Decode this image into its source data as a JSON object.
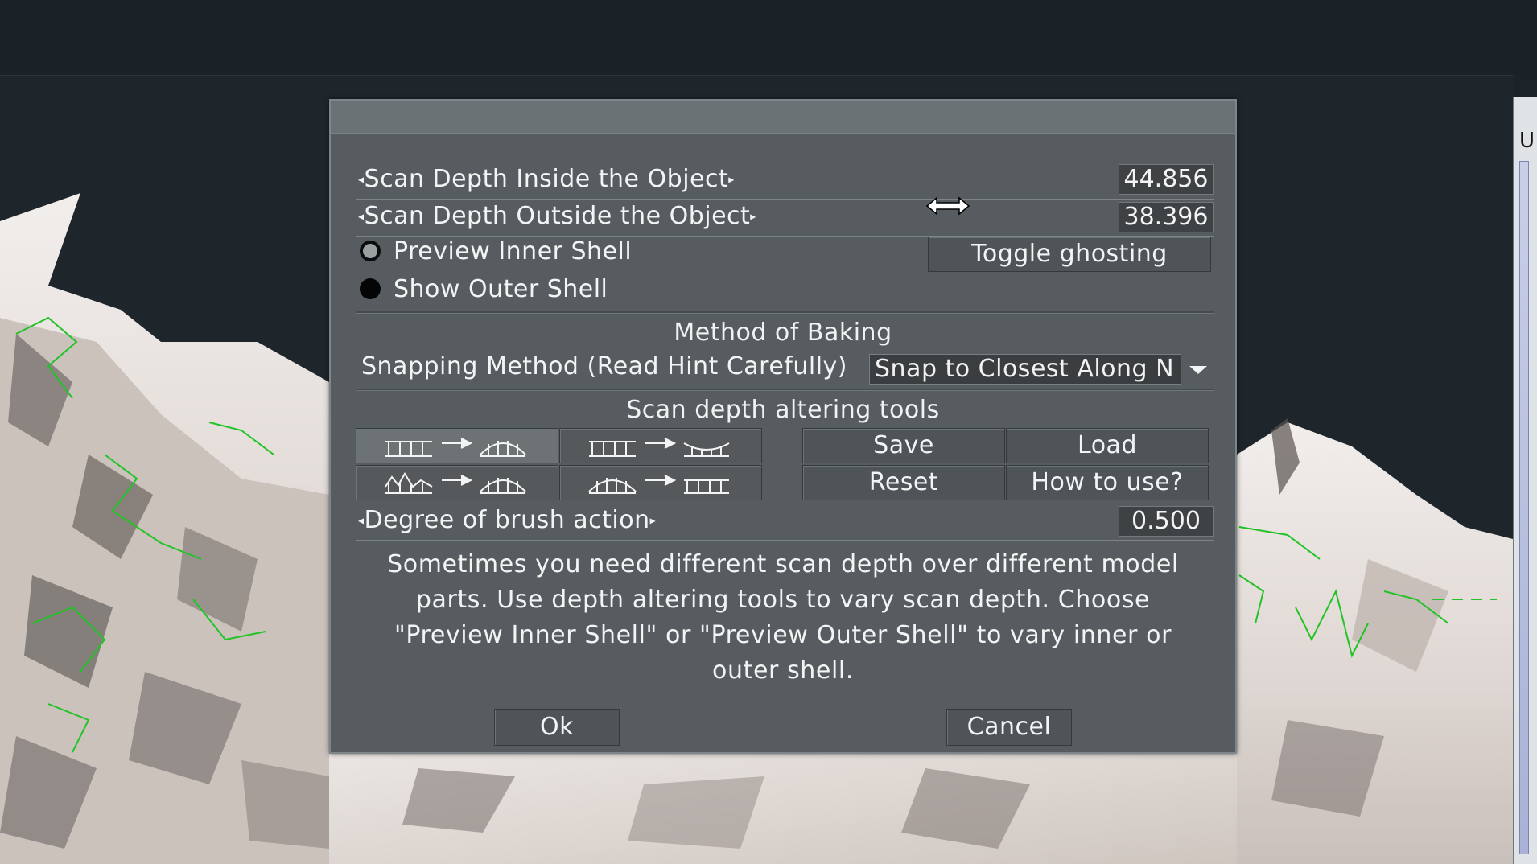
{
  "dialog": {
    "scan_depth_inside": {
      "label": "Scan Depth Inside the Object",
      "value": "44.856"
    },
    "scan_depth_outside": {
      "label": "Scan Depth Outside the Object",
      "value": "38.396"
    },
    "preview_inner_shell": {
      "label": "Preview Inner Shell",
      "selected": false
    },
    "show_outer_shell": {
      "label": "Show Outer Shell",
      "selected": true
    },
    "toggle_ghosting_label": "Toggle ghosting",
    "method_heading": "Method of Baking",
    "snapping": {
      "label": "Snapping Method (Read Hint Carefully)",
      "value": "Snap to Closest Along N"
    },
    "tools_heading": "Scan depth altering tools",
    "tool_buttons": [
      {
        "icon": "flat-to-convex-icon"
      },
      {
        "icon": "flat-to-concave-icon"
      },
      {
        "icon": "bumpy-to-convex-icon"
      },
      {
        "icon": "convex-to-flat-icon"
      }
    ],
    "save_label": "Save",
    "load_label": "Load",
    "reset_label": "Reset",
    "how_to_use_label": "How to use?",
    "brush_degree": {
      "label": "Degree of brush action",
      "value": "0.500"
    },
    "hint_text": "Sometimes you need different scan depth over different model parts. Use depth altering tools to vary scan depth. Choose \"Preview Inner Shell\" or \"Preview Outer Shell\" to vary inner or outer shell.",
    "ok_label": "Ok",
    "cancel_label": "Cancel"
  },
  "right_panel": {
    "letter": "U"
  },
  "colors": {
    "dialog_bg": "#565c5f",
    "viewport_bg": "#1e262c",
    "wireframe_green": "#22c326"
  }
}
